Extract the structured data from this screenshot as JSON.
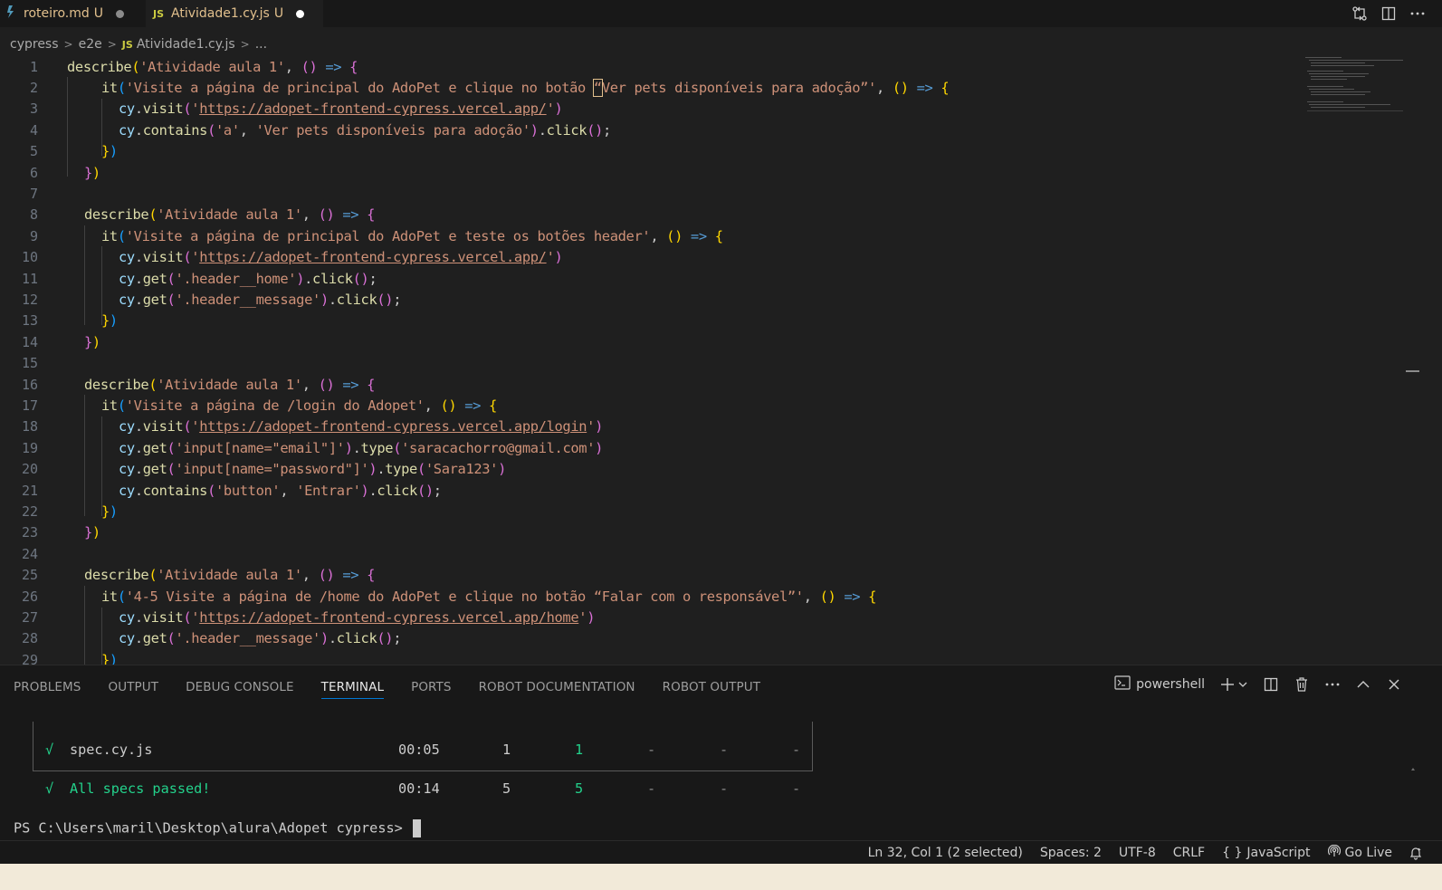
{
  "tabs": [
    {
      "name": "roteiro.md",
      "status": "U",
      "icon": "markdown-icon",
      "active": false
    },
    {
      "name": "Atividade1.cy.js",
      "status": "U",
      "icon": "js-file-icon",
      "active": true
    }
  ],
  "breadcrumb": {
    "folder1": "cypress",
    "folder2": "e2e",
    "file_icon": "JS",
    "file": "Atividade1.cy.js",
    "more": "..."
  },
  "editor": {
    "line_numbers": [
      "1",
      "2",
      "3",
      "4",
      "5",
      "6",
      "7",
      "8",
      "9",
      "10",
      "11",
      "12",
      "13",
      "14",
      "15",
      "16",
      "17",
      "18",
      "19",
      "20",
      "21",
      "22",
      "23",
      "24",
      "25",
      "26",
      "27",
      "28",
      "29"
    ],
    "tokens": {
      "describe": "describe",
      "it": "it",
      "cy": "cy",
      "visit": "visit",
      "contains": "contains",
      "get": "get",
      "type": "type",
      "click": "click",
      "arrow": "=>",
      "desc_title": "'Atividade aula 1'",
      "it1": "'Visite a página de principal do AdoPet e clique no botão ",
      "it1_box": "“",
      "it1_end": "Ver pets disponíveis para adoção”'",
      "url_root_q1": "'",
      "url_root": "https://adopet-frontend-cypress.vercel.app/",
      "url_root_q2": "'",
      "c1_a": "'a'",
      "c1_b": "'Ver pets disponíveis para adoção'",
      "it2": "'Visite a página de principal do AdoPet e teste os botões header'",
      "sel_home": "'.header__home'",
      "sel_msg": "'.header__message'",
      "it3": "'Visite a página de /login do Adopet'",
      "url_login": "https://adopet-frontend-cypress.vercel.app/login",
      "sel_email": "'input[name=\"email\"]'",
      "val_email": "'saracachorro@gmail.com'",
      "sel_pass": "'input[name=\"password\"]'",
      "val_pass": "'Sara123'",
      "c3_a": "'button'",
      "c3_b": "'Entrar'",
      "it4": "'4-5 Visite a página de /home do AdoPet e clique no botão “Falar com o responsável”'",
      "url_home": "https://adopet-frontend-cypress.vercel.app/home"
    }
  },
  "panel": {
    "tabs": [
      "PROBLEMS",
      "OUTPUT",
      "DEBUG CONSOLE",
      "TERMINAL",
      "PORTS",
      "ROBOT DOCUMENTATION",
      "ROBOT OUTPUT"
    ],
    "active_tab": "TERMINAL",
    "shell": "powershell"
  },
  "terminal": {
    "row1": {
      "check": "√",
      "spec": "spec.cy.js",
      "time": "00:05",
      "tests": "1",
      "passing": "1",
      "failing": "-",
      "pending": "-",
      "skipped": "-"
    },
    "row2": {
      "check": "√",
      "label": "All specs passed!",
      "time": "00:14",
      "tests": "5",
      "passing": "5",
      "failing": "-",
      "pending": "-",
      "skipped": "-"
    },
    "prompt": "PS C:\\Users\\maril\\Desktop\\alura\\Adopet cypress> "
  },
  "statusbar": {
    "position": "Ln 32, Col 1 (2 selected)",
    "spaces": "Spaces: 2",
    "encoding": "UTF-8",
    "eol": "CRLF",
    "language_icon": "{ }",
    "language": "JavaScript",
    "golive": "Go Live"
  },
  "colors": {
    "accent": "#0078d4",
    "modified": "#e2c08d",
    "success": "#23d18b"
  }
}
